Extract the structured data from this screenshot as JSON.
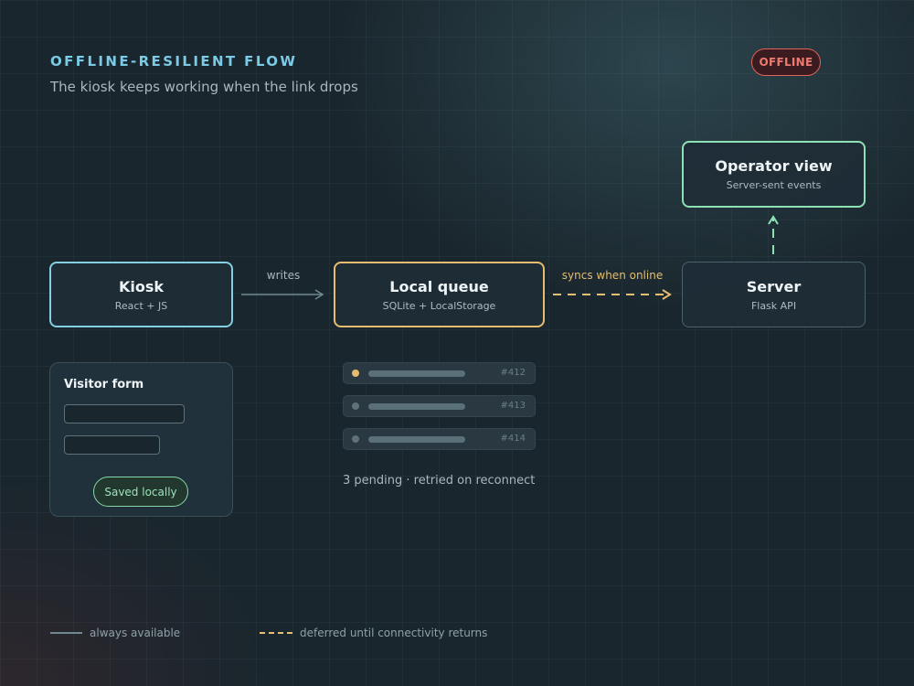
{
  "header": {
    "title": "OFFLINE-RESILIENT FLOW",
    "subtitle": "The kiosk keeps working when the link drops",
    "status_badge": "OFFLINE"
  },
  "nodes": {
    "kiosk": {
      "title": "Kiosk",
      "subtitle": "React + JS"
    },
    "queue": {
      "title": "Local queue",
      "subtitle": "SQLite + LocalStorage"
    },
    "server": {
      "title": "Server",
      "subtitle": "Flask API"
    },
    "operator": {
      "title": "Operator view",
      "subtitle": "Server-sent events"
    }
  },
  "edges": {
    "writes": "writes",
    "sync": "syncs when online"
  },
  "visitor_form": {
    "title": "Visitor form",
    "saved_label": "Saved locally"
  },
  "queue_items": [
    {
      "id": "#412",
      "dot_color": "#e6bd6e"
    },
    {
      "id": "#413",
      "dot_color": "#5f727a"
    },
    {
      "id": "#414",
      "dot_color": "#5f727a"
    }
  ],
  "pending_note": "3 pending · retried on reconnect",
  "legend": {
    "solid": "always available",
    "dashed": "deferred until connectivity returns"
  },
  "colors": {
    "solid_edge": "#6f8890",
    "deferred_edge": "#e6bd6e",
    "operator_edge": "#8ee0b5",
    "offline": "#e0625a"
  }
}
